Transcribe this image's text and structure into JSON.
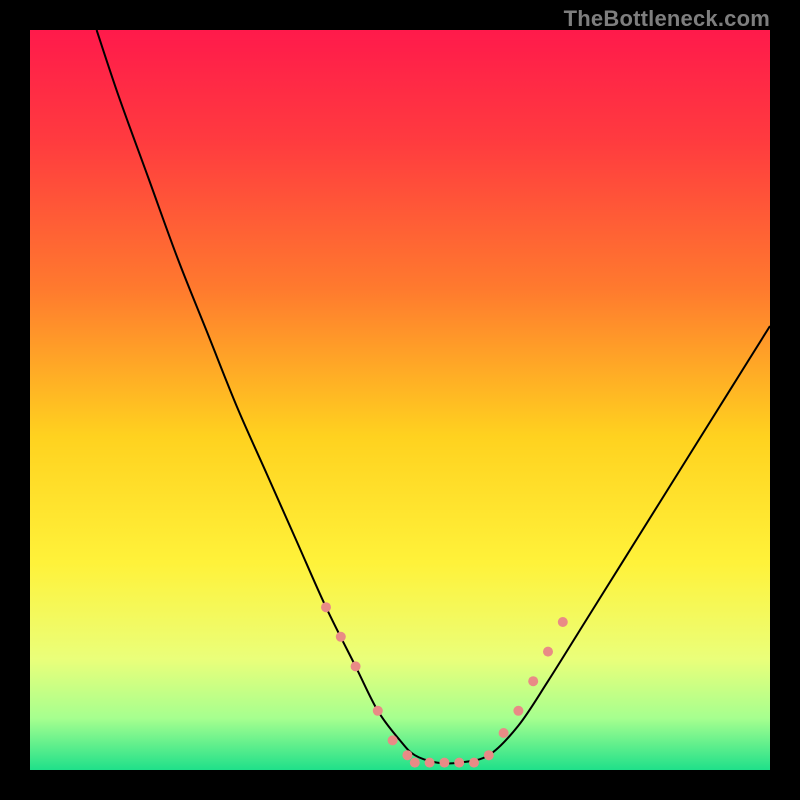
{
  "watermark": {
    "text": "TheBottleneck.com"
  },
  "chart_data": {
    "type": "line",
    "title": "",
    "xlabel": "",
    "ylabel": "",
    "xlim": [
      0,
      100
    ],
    "ylim": [
      0,
      100
    ],
    "grid": false,
    "legend": false,
    "background_gradient_stops": [
      {
        "offset": 0.0,
        "color": "#ff1a4b"
      },
      {
        "offset": 0.15,
        "color": "#ff3b3f"
      },
      {
        "offset": 0.35,
        "color": "#ff7a2e"
      },
      {
        "offset": 0.55,
        "color": "#ffd21f"
      },
      {
        "offset": 0.72,
        "color": "#fff23a"
      },
      {
        "offset": 0.85,
        "color": "#eaff7a"
      },
      {
        "offset": 0.93,
        "color": "#a6ff8f"
      },
      {
        "offset": 1.0,
        "color": "#1fe08a"
      }
    ],
    "series": [
      {
        "name": "curve",
        "color": "#000000",
        "width": 2,
        "x": [
          9,
          12,
          16,
          20,
          24,
          28,
          32,
          36,
          40,
          44,
          47,
          50,
          52,
          55,
          58,
          62,
          66,
          70,
          75,
          80,
          85,
          90,
          95,
          100
        ],
        "y": [
          100,
          91,
          80,
          69,
          59,
          49,
          40,
          31,
          22,
          14,
          8,
          4,
          2,
          1,
          1,
          2,
          6,
          12,
          20,
          28,
          36,
          44,
          52,
          60
        ]
      }
    ],
    "marker_clusters": [
      {
        "name": "left-slope-markers",
        "color": "#e98b86",
        "radius": 5,
        "points": [
          {
            "x": 40,
            "y": 22
          },
          {
            "x": 42,
            "y": 18
          },
          {
            "x": 44,
            "y": 14
          },
          {
            "x": 47,
            "y": 8
          },
          {
            "x": 49,
            "y": 4
          },
          {
            "x": 51,
            "y": 2
          }
        ]
      },
      {
        "name": "bottom-markers",
        "color": "#e98b86",
        "radius": 5,
        "points": [
          {
            "x": 52,
            "y": 1
          },
          {
            "x": 54,
            "y": 1
          },
          {
            "x": 56,
            "y": 1
          },
          {
            "x": 58,
            "y": 1
          },
          {
            "x": 60,
            "y": 1
          },
          {
            "x": 62,
            "y": 2
          }
        ]
      },
      {
        "name": "right-slope-markers",
        "color": "#e98b86",
        "radius": 5,
        "points": [
          {
            "x": 64,
            "y": 5
          },
          {
            "x": 66,
            "y": 8
          },
          {
            "x": 68,
            "y": 12
          },
          {
            "x": 70,
            "y": 16
          },
          {
            "x": 72,
            "y": 20
          }
        ]
      }
    ]
  }
}
